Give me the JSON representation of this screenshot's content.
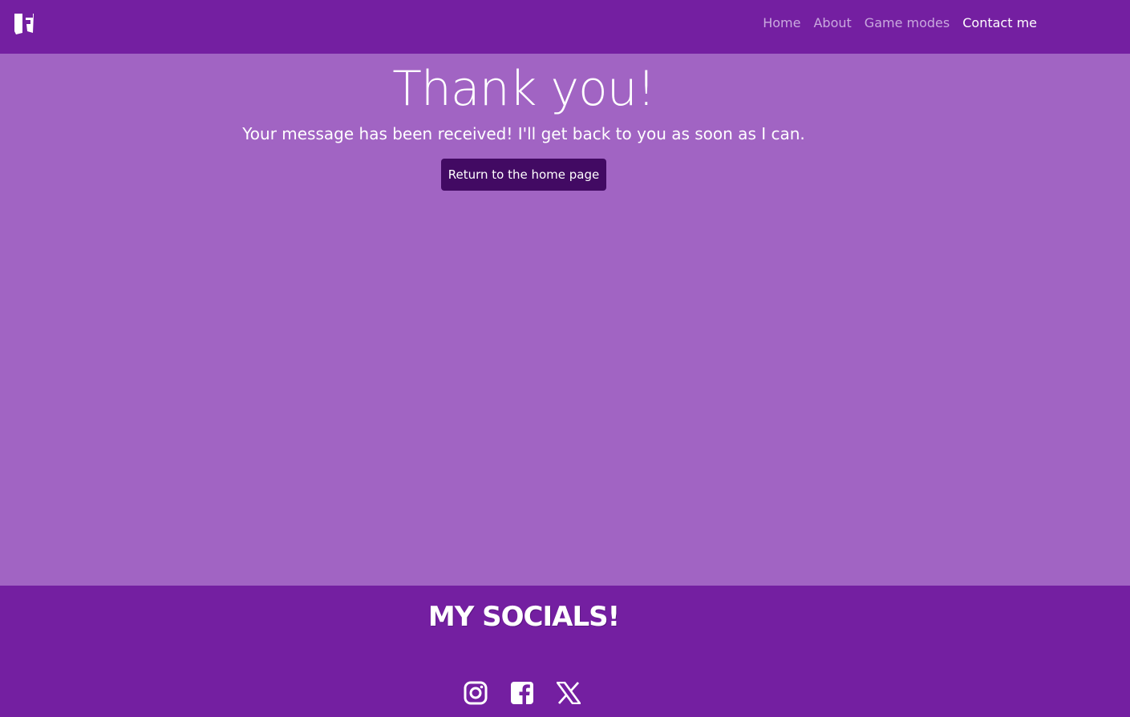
{
  "navbar": {
    "logo_icon": "fortnite-f-logo-icon",
    "links": [
      {
        "label": "Home"
      },
      {
        "label": "About"
      },
      {
        "label": "Game modes"
      },
      {
        "label": "Contact me",
        "active": true
      }
    ]
  },
  "main": {
    "title": "Thank you!",
    "message": "Your message has been received! I'll get back to you as soon as I can.",
    "button_label": "Return to the home page"
  },
  "footer": {
    "heading": "MY SOCIALS!",
    "icons": [
      "instagram-icon",
      "facebook-icon",
      "x-twitter-icon"
    ]
  },
  "colors": {
    "nav_bg": "#741fa1",
    "main_bg": "#a164c3",
    "button_bg": "#420a63",
    "nav_link_inactive": "#c9a9de",
    "text": "#ffffff"
  }
}
